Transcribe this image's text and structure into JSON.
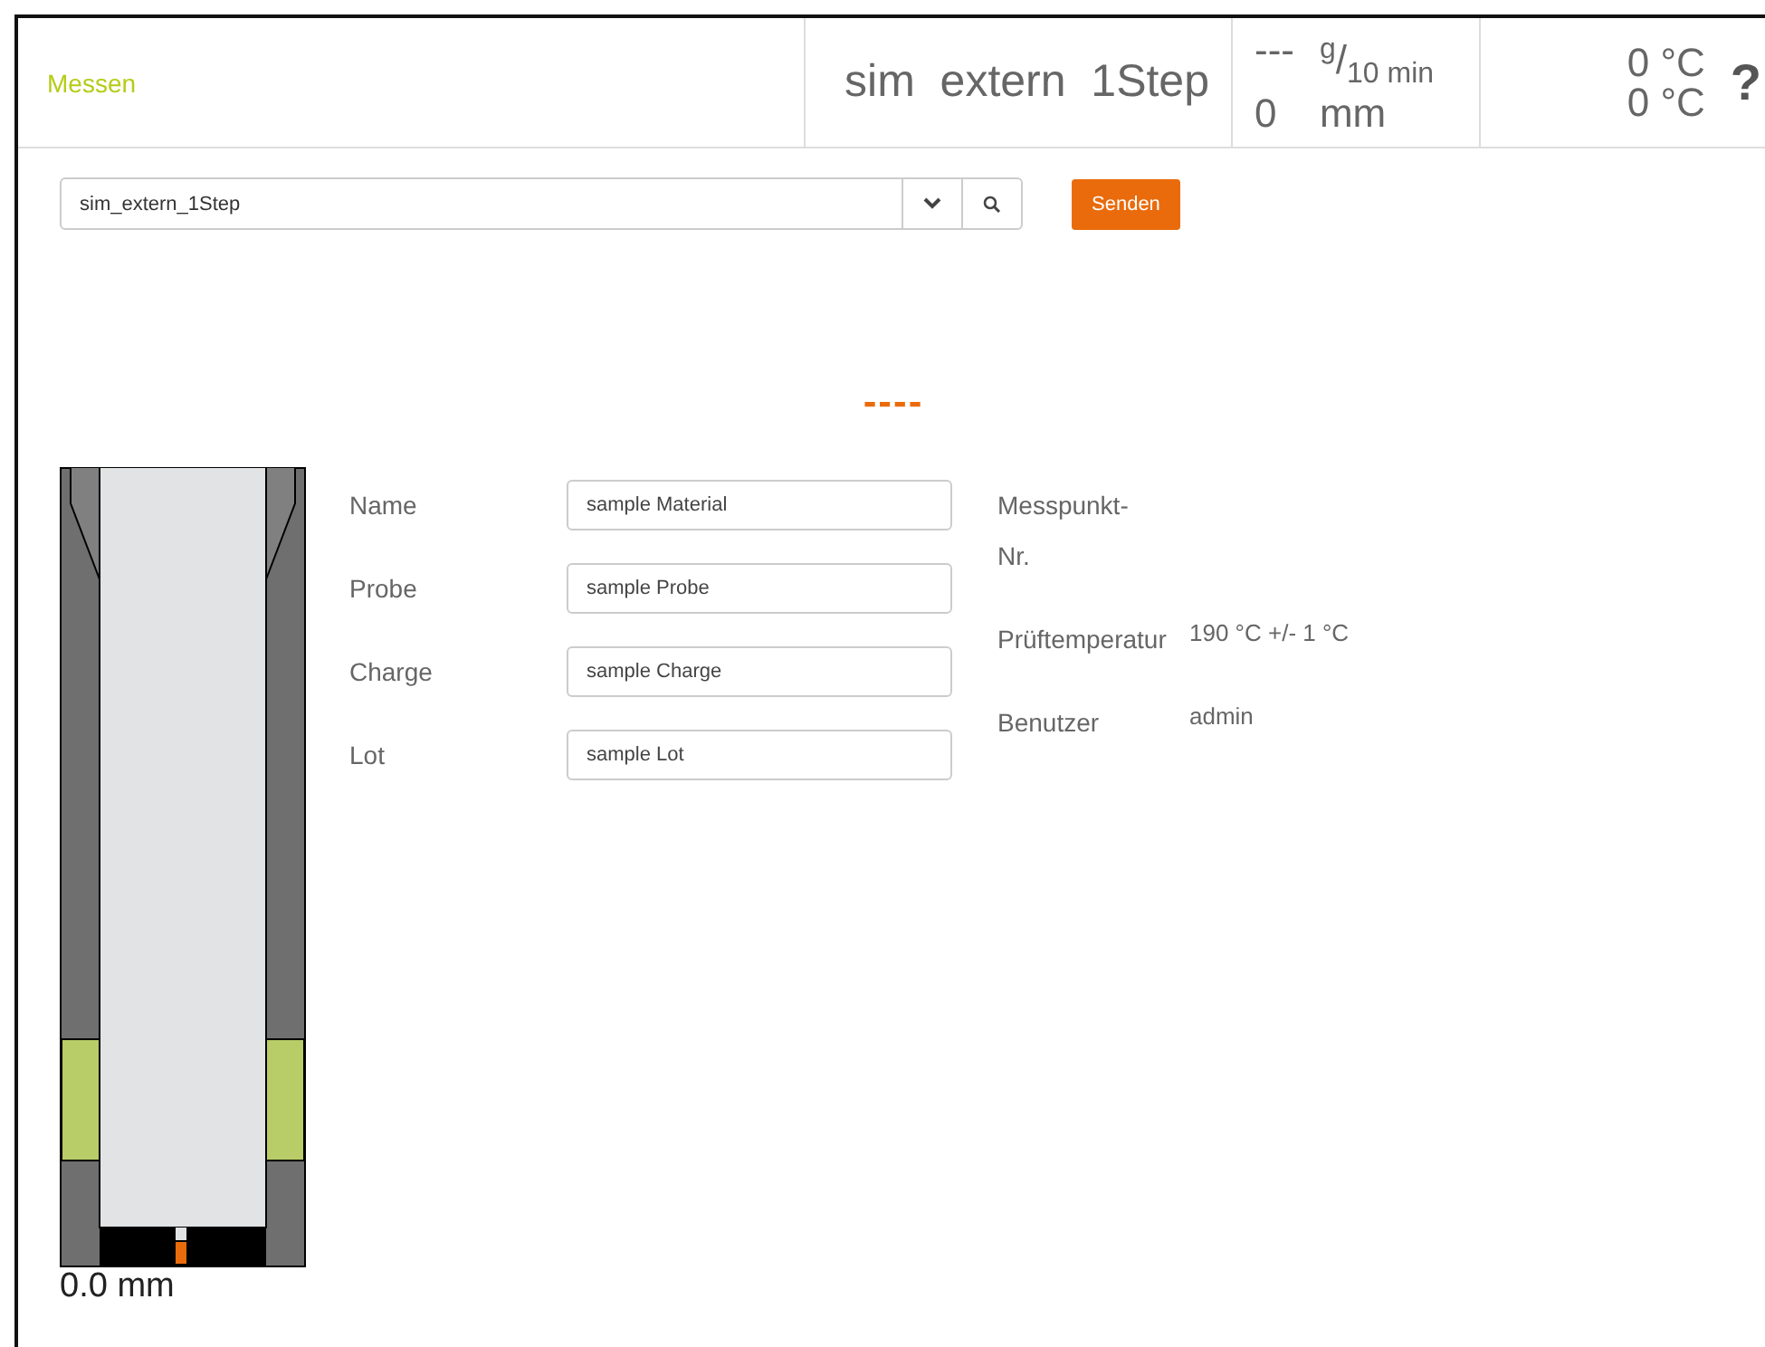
{
  "header": {
    "title": "Messen",
    "program": "sim  extern  1Step",
    "rate_value": "---",
    "rate_unit": "$^{g}$/$_{10 min}$",
    "distance_value": "0",
    "distance_unit": "mm",
    "temperatures": [
      "0 °C",
      "0 °C"
    ],
    "help": "?"
  },
  "toolbar": {
    "program_select": {
      "value": "sim_extern_1Step"
    },
    "send_button": "Senden"
  },
  "result": "----",
  "drawing": {
    "position": "0.0 mm"
  },
  "form": [
    {
      "label": "Name",
      "value": "sample Material"
    },
    {
      "label": "Probe",
      "value": "sample Probe"
    },
    {
      "label": "Charge",
      "value": "sample Charge"
    },
    {
      "label": "Lot",
      "value": "sample Lot"
    }
  ],
  "info": [
    {
      "label": "Messpunkt-Nr."
    },
    {
      "label": "Prüftemperatur",
      "value": "190 °C +/- 1 °C"
    },
    {
      "label": "Benutzer",
      "value": "admin"
    }
  ]
}
